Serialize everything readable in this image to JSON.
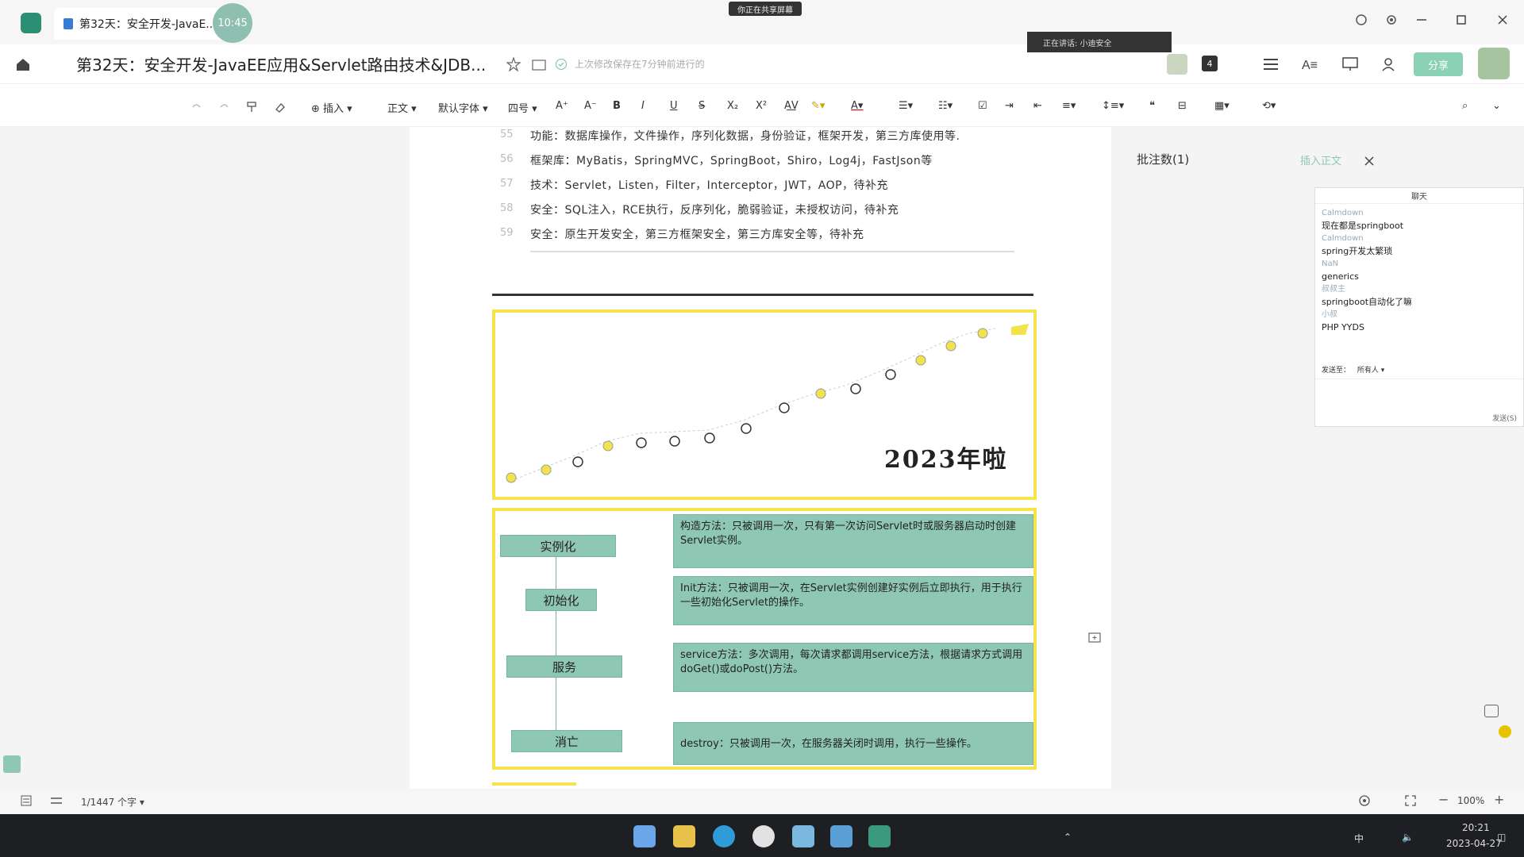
{
  "titlebar": {
    "tab_title": "第32天：安全开发-JavaE...",
    "clock_bubble": "10:45",
    "share_banner": "你正在共享屏幕"
  },
  "header": {
    "doc_title": "第32天：安全开发-JavaEE应用&Servlet路由技术&JDB...",
    "save_status": "上次修改保存在7分钟前进行的",
    "speaking": "正在讲话: 小迪安全",
    "collaborators_count": "4",
    "share_label": "分享"
  },
  "toolbar": {
    "insert": "插入",
    "style": "正文",
    "font": "默认字体",
    "size": "四号"
  },
  "doc": {
    "lines": [
      {
        "num": "55",
        "text": "功能：数据库操作，文件操作，序列化数据，身份验证，框架开发，第三方库使用等."
      },
      {
        "num": "56",
        "text": "框架库：MyBatis，SpringMVC，SpringBoot，Shiro，Log4j，FastJson等"
      },
      {
        "num": "57",
        "text": "技术：Servlet，Listen，Filter，Interceptor，JWT，AOP，待补充"
      },
      {
        "num": "58",
        "text": "安全：SQL注入，RCE执行，反序列化，脆弱验证，未授权访问，待补充"
      },
      {
        "num": "59",
        "text": "安全：原生开发安全，第三方框架安全，第三方库安全等，待补充"
      }
    ],
    "roadmap_title": "2023年啦",
    "lifecycle": [
      {
        "stage": "实例化",
        "desc": "构造方法：只被调用一次，只有第一次访问Servlet时或服务器启动时创建Servlet实例。"
      },
      {
        "stage": "初始化",
        "desc": "Init方法：只被调用一次，在Servlet实例创建好实例后立即执行，用于执行一些初始化Servlet的操作。"
      },
      {
        "stage": "服务",
        "desc": "service方法：多次调用，每次请求都调用service方法，根据请求方式调用doGet()或doPost()方法。"
      },
      {
        "stage": "消亡",
        "desc": "destroy：只被调用一次，在服务器关闭时调用，执行一些操作。"
      }
    ]
  },
  "side": {
    "comments": "批注数(1)",
    "insert_body": "插入正文"
  },
  "chat": {
    "title": "聊天",
    "messages": [
      {
        "user": "Calmdown",
        "text": "现在都是springboot"
      },
      {
        "user": "Calmdown",
        "text": "spring开发太繁琐"
      },
      {
        "user": "NaN",
        "text": "generics"
      },
      {
        "user": "叔叔主",
        "text": "springboot自动化了嘛"
      },
      {
        "user": "小叔",
        "text": "PHP YYDS"
      }
    ],
    "send_to_label": "发送至：",
    "send_to_value": "所有人",
    "send_button": "发送(S)"
  },
  "status": {
    "word_count": "1/1447 个字",
    "zoom": "100%"
  },
  "taskbar": {
    "time": "20:21",
    "date": "2023-04-27",
    "ime": "中"
  }
}
